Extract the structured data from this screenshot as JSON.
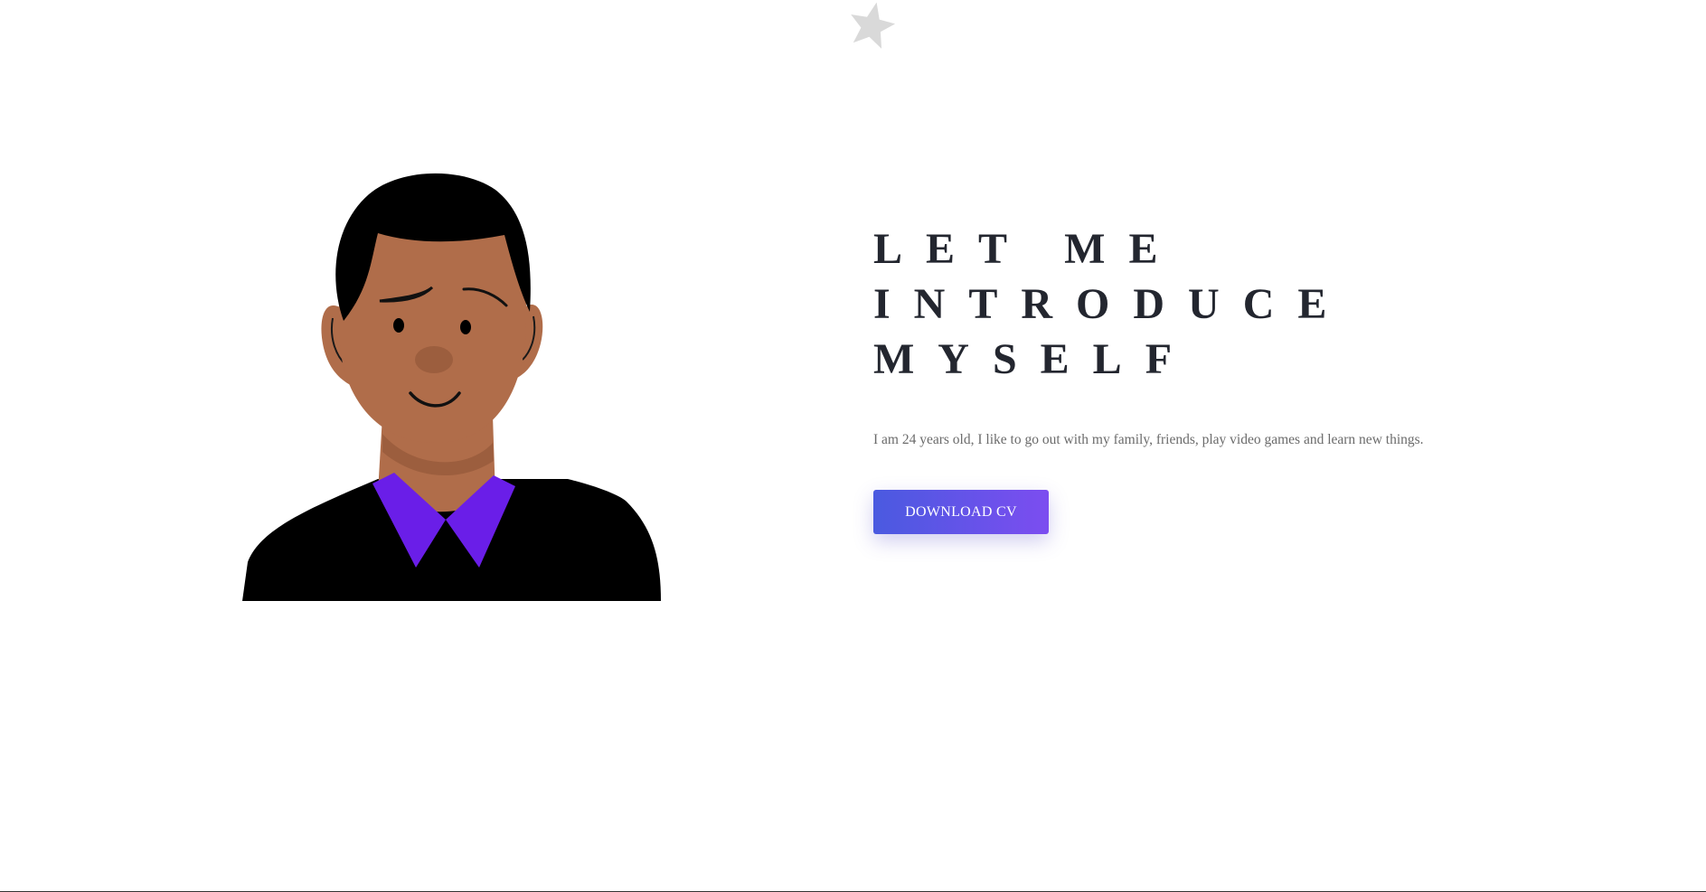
{
  "hero": {
    "heading_lines": [
      "LET ME",
      "INTRODUCE",
      "MYSELF"
    ],
    "bio": "I am 24 years old, I like to go out with my family, friends, play video games and learn new things.",
    "cta_label": "DOWNLOAD CV"
  },
  "colors": {
    "heading": "#23262f",
    "bio": "#6b6b6b",
    "button_gradient_start": "#4a5ae0",
    "button_gradient_end": "#7c4df0",
    "collar": "#6a1ee8",
    "skin": "#b06d4a",
    "star": "#d9d9d9"
  },
  "icons": {
    "decor_star": "star-icon",
    "illustration": "avatar-illustration"
  }
}
